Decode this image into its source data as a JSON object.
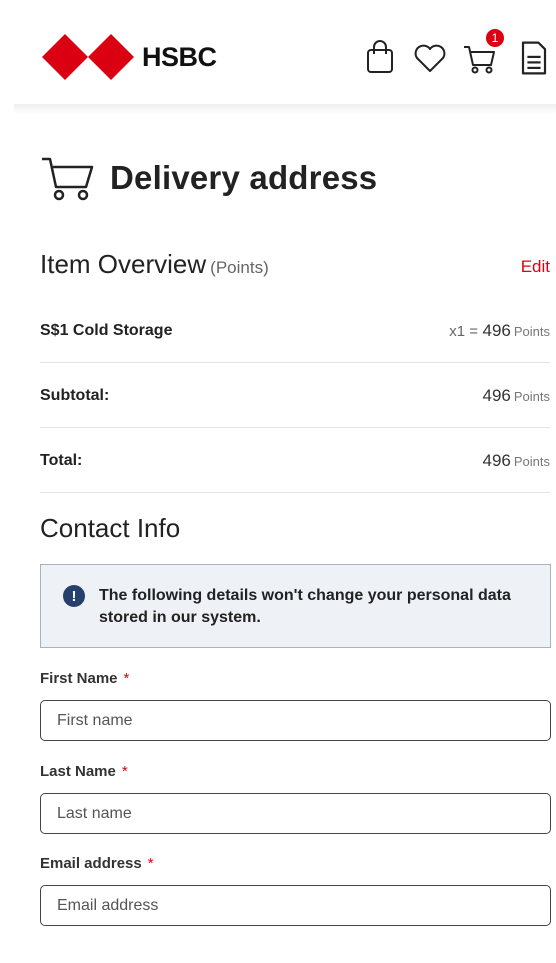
{
  "brand": {
    "name": "HSBC",
    "red": "#db0011"
  },
  "header": {
    "icons": [
      "shopping-bag-icon",
      "heart-icon",
      "cart-icon",
      "document-icon"
    ],
    "cart_badge": "1"
  },
  "page": {
    "title": "Delivery address"
  },
  "overview": {
    "title": "Item Overview",
    "subtitle": "(Points)",
    "edit_label": "Edit",
    "item": {
      "name": "S$1 Cold Storage",
      "qty": "x1 =",
      "points": "496",
      "unit": "Points"
    },
    "subtotal": {
      "label": "Subtotal:",
      "points": "496",
      "unit": "Points"
    },
    "total": {
      "label": "Total:",
      "points": "496",
      "unit": "Points"
    }
  },
  "contact": {
    "title": "Contact Info",
    "notice_icon": "!",
    "notice": "The following details won't change your personal data stored in our system.",
    "required_mark": "*",
    "first_name": {
      "label": "First Name",
      "placeholder": "First name"
    },
    "last_name": {
      "label": "Last Name",
      "placeholder": "Last name"
    },
    "email": {
      "label": "Email address",
      "placeholder": "Email address"
    }
  }
}
